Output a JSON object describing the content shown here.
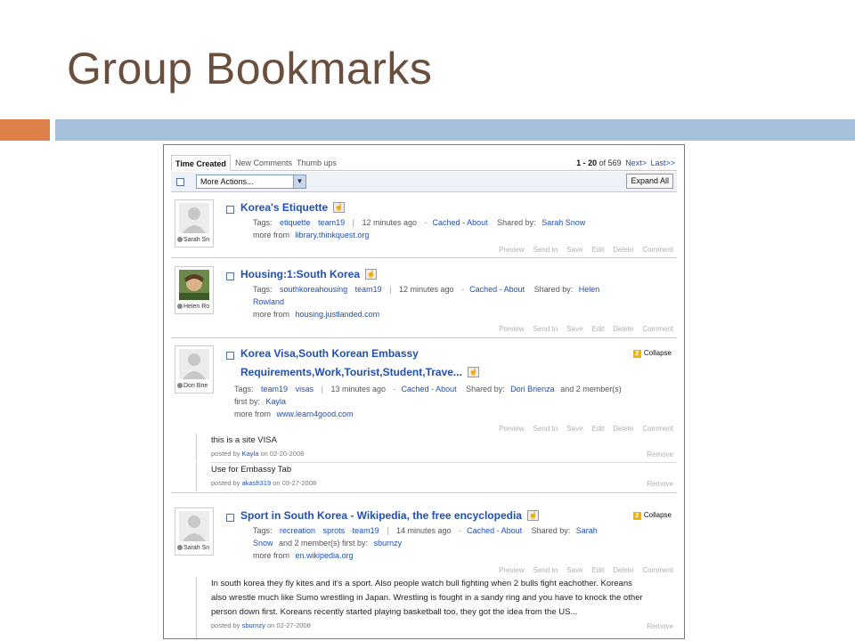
{
  "slide": {
    "title": "Group Bookmarks"
  },
  "tabs": [
    "Time Created",
    "New Comments",
    "Thumb ups"
  ],
  "pager": {
    "range": "1 - 20",
    "of_text": "of 569",
    "next": "Next>",
    "last": "Last>>"
  },
  "toolbar": {
    "select_value": "More Actions...",
    "expand_label": "Expand All"
  },
  "labels": {
    "tags": "Tags:",
    "cached": "Cached",
    "about": "About",
    "shared_by": "Shared by:",
    "more_from": "more from",
    "first_by": "first by:",
    "posted_by": "posted by",
    "on": "on",
    "collapse": "Collapse",
    "remove": "Remove",
    "actions": [
      "Preview",
      "Send to",
      "Save",
      "Edit",
      "Delete",
      "Comment"
    ]
  },
  "bookmarks": [
    {
      "title": "Korea's Etiquette",
      "avatar_name": "Sarah Sn",
      "tags": [
        "etiquette",
        "team19"
      ],
      "time": "12 minutes ago",
      "shared_by": "Sarah Snow",
      "more_from": "library.thinkquest.org"
    },
    {
      "title": "Housing:1:South Korea",
      "avatar_name": "Helen Ro",
      "tags": [
        "southkoreahousing",
        "team19"
      ],
      "time": "12 minutes ago",
      "shared_by_line1": "Helen",
      "shared_by_line2": "Rowland",
      "more_from": "housing.justlanded.com"
    },
    {
      "title_line1": "Korea Visa,South Korean Embassy",
      "title_line2": "Requirements,Work,Tourist,Student,Trave...",
      "avatar_name": "Dori Brie",
      "tags": [
        "team19",
        "visas"
      ],
      "time": "13 minutes ago",
      "shared_by": "Dori Brienza",
      "extra": "and 2 member(s)",
      "first_by": "Kayla",
      "more_from": "www.learn4good.com",
      "badge": "2",
      "comments": [
        {
          "text": "this is a site VISA",
          "user": "Kayla",
          "date": "02-20-2008"
        },
        {
          "text": "Use for Embassy Tab",
          "user": "akash319",
          "date": "03-27-2008"
        }
      ]
    },
    {
      "title": "Sport in South Korea - Wikipedia, the free encyclopedia",
      "avatar_name": "Sarah Sn",
      "tags": [
        "recreation",
        "sprots",
        "team19"
      ],
      "time": "14 minutes ago",
      "shared_by_line1": "Sarah",
      "shared_by_line2": "Snow",
      "extra": "and 2 member(s) first by:",
      "first_by": "sburnzy",
      "more_from": "en.wikipedia.org",
      "badge": "2",
      "comments": [
        {
          "line1": "In south korea they fly kites and it's a sport. Also people watch bull fighting when 2 bulls fight eachother. Koreans",
          "line2": "also wrestle much like Sumo wrestling in Japan. Wrestling is fought in a sandy ring and you have to knock the other",
          "line3": "person down first. Koreans recently started playing basketball too, they got the idea from the US...",
          "user": "sburnzy",
          "date": "02-27-2008"
        }
      ]
    }
  ],
  "colors": {
    "title": "#6b4f3e",
    "accent_bar": "#dd8047",
    "main_bar": "#a7c0dc",
    "link": "#1f4fb8"
  }
}
